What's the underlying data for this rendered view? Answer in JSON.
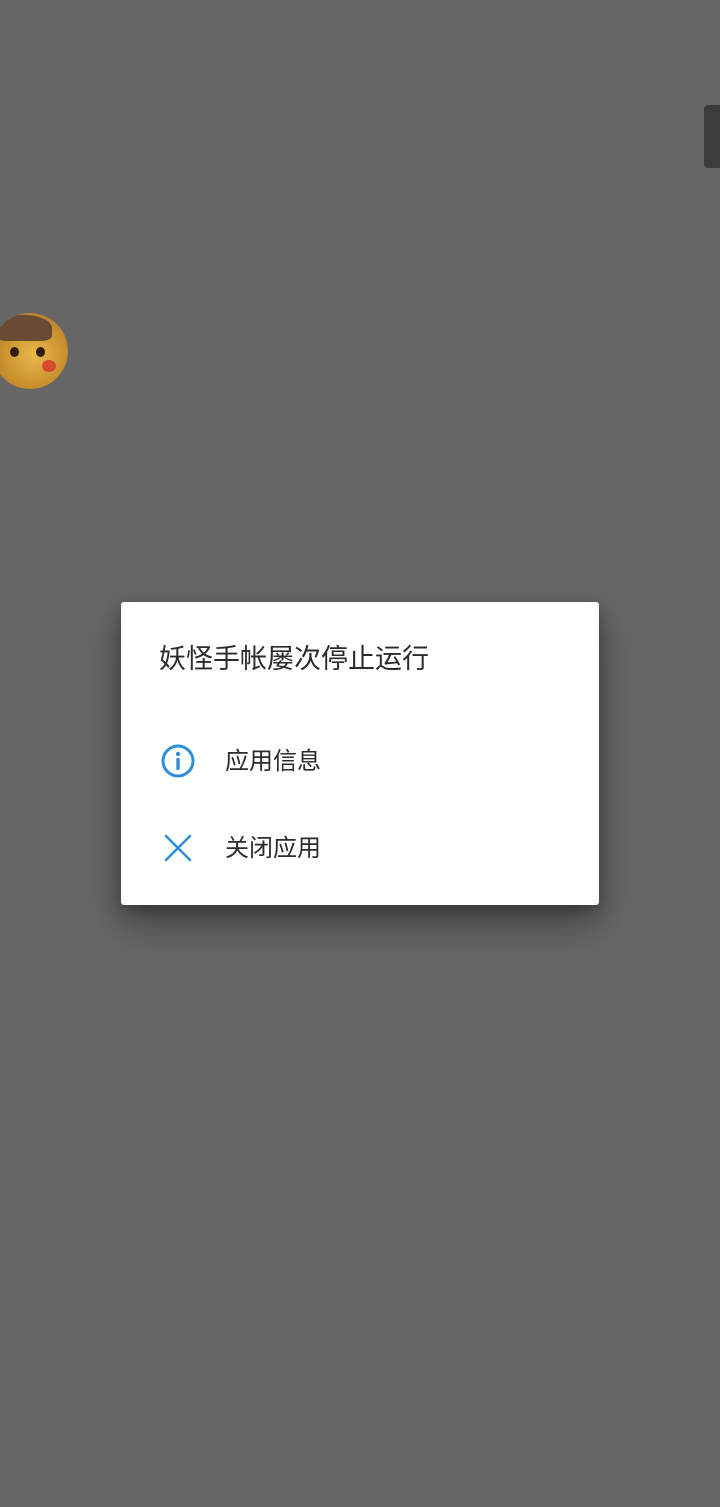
{
  "dialog": {
    "title": "妖怪手帐屡次停止运行",
    "items": [
      {
        "label": "应用信息",
        "icon": "info-icon"
      },
      {
        "label": "关闭应用",
        "icon": "close-icon"
      }
    ]
  },
  "colors": {
    "accent": "#2e8fd8",
    "scrim": "#666666",
    "dialog_bg": "#ffffff",
    "text": "#2b2b2b"
  }
}
